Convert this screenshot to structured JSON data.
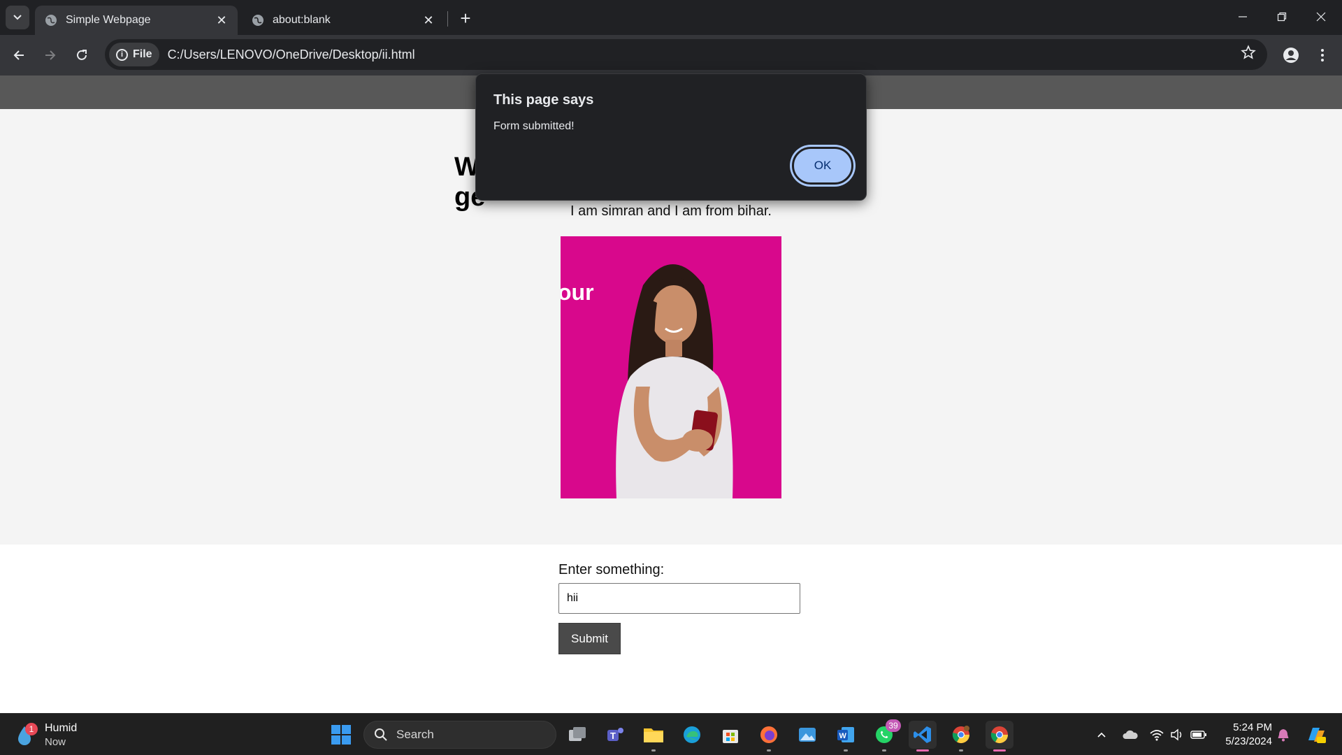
{
  "browser": {
    "tabs": [
      {
        "title": "Simple Webpage",
        "active": true
      },
      {
        "title": "about:blank",
        "active": false
      }
    ],
    "address": {
      "chip_label": "File",
      "url": "C:/Users/LENOVO/OneDrive/Desktop/ii.html"
    }
  },
  "page": {
    "heading_left": "W",
    "heading_right": "ge",
    "intro": "I am simran and I am from bihar.",
    "photo_text": "our",
    "form": {
      "label": "Enter something:",
      "input_value": "hii",
      "submit_label": "Submit"
    }
  },
  "dialog": {
    "title": "This page says",
    "message": "Form submitted!",
    "ok_label": "OK"
  },
  "taskbar": {
    "weather": {
      "title": "Humid",
      "subtitle": "Now",
      "badge": "1"
    },
    "search_placeholder": "Search",
    "whatsapp_badge": "39",
    "clock_time": "5:24 PM",
    "clock_date": "5/23/2024"
  },
  "colors": {
    "accent": "#a8c7fa",
    "photo_bg": "#d8088c",
    "page_header": "#585858",
    "submit_bg": "#4a4a4a"
  }
}
